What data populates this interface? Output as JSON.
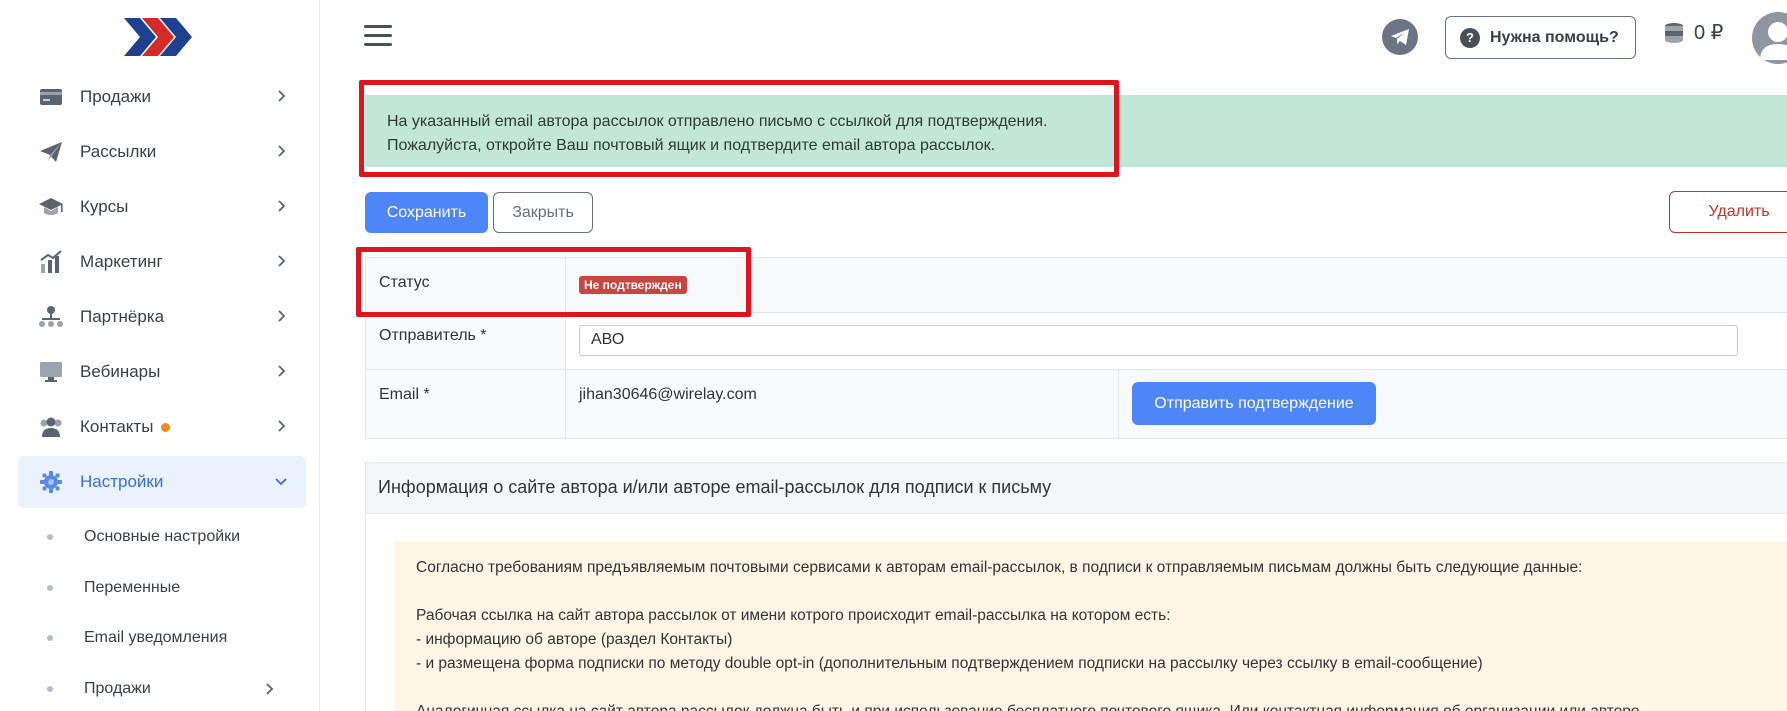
{
  "sidebar": {
    "items": [
      {
        "label": "Продажи",
        "icon": "card-icon"
      },
      {
        "label": "Рассылки",
        "icon": "paper-plane-icon"
      },
      {
        "label": "Курсы",
        "icon": "graduation-cap-icon"
      },
      {
        "label": "Маркетинг",
        "icon": "chart-icon"
      },
      {
        "label": "Партнёрка",
        "icon": "partners-icon"
      },
      {
        "label": "Вебинары",
        "icon": "monitor-icon"
      },
      {
        "label": "Контакты",
        "icon": "contacts-icon"
      },
      {
        "label": "Настройки",
        "icon": "gear-icon"
      }
    ],
    "subitems": [
      {
        "label": "Основные настройки"
      },
      {
        "label": "Переменные"
      },
      {
        "label": "Email уведомления"
      },
      {
        "label": "Продажи"
      }
    ]
  },
  "header": {
    "help_label": "Нужна помощь?",
    "help_icon": "?",
    "balance": "0 ₽"
  },
  "alert": {
    "line1": "На указанный email автора рассылок отправлено письмо с ссылкой для подтверждения.",
    "line2": "Пожалуйста, откройте Ваш почтовый ящик и подтвердите email автора рассылок."
  },
  "toolbar": {
    "save_label": "Сохранить",
    "close_label": "Закрыть",
    "delete_label": "Удалить"
  },
  "form": {
    "status_label": "Статус",
    "status_value": "Не подтвержден",
    "sender_label": "Отправитель *",
    "sender_value": "АВО",
    "email_label": "Email *",
    "email_value": "jihan30646@wirelay.com",
    "send_confirm_label": "Отправить подтверждение"
  },
  "info": {
    "title": "Информация о сайте автора и/или авторе email-рассылок для подписи к письму",
    "p1": "Согласно требованиям предъявляемым почтовыми сервисами к авторам email-рассылок, в подписи к отправляемым письмам должны быть следующие данные:",
    "p2": "Рабочая ссылка на сайт автора рассылок от имени котрого происходит email-рассылка на котором есть:",
    "p3": "- информацию об авторе (раздел Контакты)",
    "p4": "- и размещена форма подписки по методу double opt-in (дополнительным подтверждением подписки на рассылку через ссылку в email-сообщение)",
    "p5": "Аналогичная ссылка на сайт автора рассылок должна быть и при использование бесплатного почтового ящика. Или контактная информация об организации или авторе"
  },
  "colors": {
    "accent": "#4f86f7",
    "alert_bg": "#c2e6d8",
    "danger": "#c94540",
    "highlight_frame": "#e0141c",
    "info_bg": "#fff5e6"
  }
}
